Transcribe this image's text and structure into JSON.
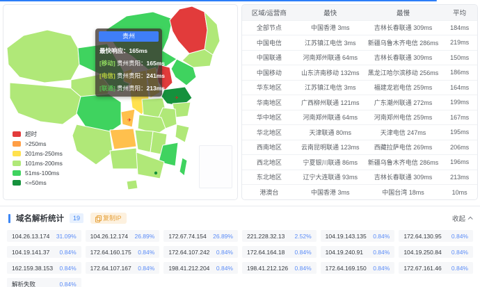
{
  "colors": {
    "accent_blue": "#2c7ef8",
    "tooltip_header": "#3f7ef7",
    "pct_blue": "#5b8cf7",
    "copy_orange": "#e6a23c",
    "badge_blue": "#4086f4",
    "red": "#e23b3b",
    "orange": "#ff9e45",
    "yellow": "#ffe14e",
    "light_green": "#b0e878",
    "bright_green": "#3fd35f",
    "dark_green": "#15913c",
    "hover_amber": "#ffc04d"
  },
  "map": {
    "tooltip": {
      "title": "贵州",
      "fastest_label": "最快响应：",
      "fastest_value": "165ms",
      "rows": [
        {
          "tag": "[移动]",
          "tag_color": "#90d95f",
          "label": "贵州贵阳：",
          "value": "165ms"
        },
        {
          "tag": "[电信]",
          "tag_color": "#bdd13f",
          "label": "贵州贵阳：",
          "value": "241ms"
        },
        {
          "tag": "[联通]",
          "tag_color": "#52b54f",
          "label": "贵州贵阳：",
          "value": "213ms"
        }
      ]
    },
    "legend": [
      {
        "label": "超时",
        "color": "#e23b3b"
      },
      {
        "label": ">250ms",
        "color": "#ff9e45"
      },
      {
        "label": "201ms-250ms",
        "color": "#ffe14e"
      },
      {
        "label": "101ms-200ms",
        "color": "#b0e878"
      },
      {
        "label": "51ms-100ms",
        "color": "#3fd35f"
      },
      {
        "label": "<=50ms",
        "color": "#15913c"
      }
    ],
    "regions": [
      {
        "id": "xinjiang",
        "color": "#b0e878"
      },
      {
        "id": "tibet",
        "color": "#b0e878"
      },
      {
        "id": "qinghai",
        "color": "#b0e878"
      },
      {
        "id": "gansu",
        "color": "#3fd35f"
      },
      {
        "id": "neimeng",
        "color": "#3fd35f"
      },
      {
        "id": "heilongjiang",
        "color": "#e23b3b"
      },
      {
        "id": "hljeast",
        "color": "#b0e878"
      },
      {
        "id": "jilin",
        "color": "#b0e878"
      },
      {
        "id": "liaoning",
        "color": "#3fd35f"
      },
      {
        "id": "hebei",
        "color": "#e23b3b"
      },
      {
        "id": "shanxi",
        "color": "#ffe14e"
      },
      {
        "id": "shaanxi",
        "color": "#ffe14e"
      },
      {
        "id": "ningxia",
        "color": "#ffe14e"
      },
      {
        "id": "shandong",
        "color": "#15913c"
      },
      {
        "id": "henan",
        "color": "#b0e878"
      },
      {
        "id": "jiangsu",
        "color": "#b0e878"
      },
      {
        "id": "anhui",
        "color": "#b0e878"
      },
      {
        "id": "hubei",
        "color": "#b0e878"
      },
      {
        "id": "chongqing",
        "color": "#ffc04d"
      },
      {
        "id": "sichuan",
        "color": "#3fd35f"
      },
      {
        "id": "guizhou",
        "color": "#ffc04d"
      },
      {
        "id": "hunan",
        "color": "#b0e878"
      },
      {
        "id": "jiangxi",
        "color": "#b0e878"
      },
      {
        "id": "zhejiang",
        "color": "#b0e878"
      },
      {
        "id": "fujian",
        "color": "#3fd35f"
      },
      {
        "id": "yunnan",
        "color": "#b0e878"
      },
      {
        "id": "guangxi",
        "color": "#b0e878"
      },
      {
        "id": "guangdong",
        "color": "#b0e878"
      },
      {
        "id": "hainan",
        "color": "#b0e878"
      },
      {
        "id": "taiwan",
        "color": "#3fd35f"
      }
    ],
    "markers": [
      "beijing",
      "jinan",
      "xian",
      "chongqing"
    ]
  },
  "latency_table": {
    "headers": [
      "区域/运营商",
      "最快",
      "最慢",
      "平均"
    ],
    "rows": [
      {
        "region": "全部节点",
        "fastest": "中国香港 3ms",
        "slowest": "吉林长春联通 309ms",
        "avg": "184ms"
      },
      {
        "region": "中国电信",
        "fastest": "江苏镇江电信 3ms",
        "slowest": "新疆乌鲁木齐电信 286ms",
        "avg": "219ms"
      },
      {
        "region": "中国联通",
        "fastest": "河南郑州联通 64ms",
        "slowest": "吉林长春联通 309ms",
        "avg": "150ms"
      },
      {
        "region": "中国移动",
        "fastest": "山东济南移动 132ms",
        "slowest": "黑龙江哈尔滨移动 256ms",
        "avg": "186ms"
      },
      {
        "region": "华东地区",
        "fastest": "江苏镇江电信 3ms",
        "slowest": "福建龙岩电信 259ms",
        "avg": "164ms"
      },
      {
        "region": "华南地区",
        "fastest": "广西柳州联通 121ms",
        "slowest": "广东潮州联通 272ms",
        "avg": "199ms"
      },
      {
        "region": "华中地区",
        "fastest": "河南郑州联通 64ms",
        "slowest": "河南郑州电信 259ms",
        "avg": "167ms"
      },
      {
        "region": "华北地区",
        "fastest": "天津联通 80ms",
        "slowest": "天津电信 247ms",
        "avg": "195ms"
      },
      {
        "region": "西南地区",
        "fastest": "云南昆明联通 123ms",
        "slowest": "西藏拉萨电信 269ms",
        "avg": "206ms"
      },
      {
        "region": "西北地区",
        "fastest": "宁夏银川联通 86ms",
        "slowest": "新疆乌鲁木齐电信 286ms",
        "avg": "196ms"
      },
      {
        "region": "东北地区",
        "fastest": "辽宁大连联通 93ms",
        "slowest": "吉林长春联通 309ms",
        "avg": "213ms"
      },
      {
        "region": "港澳台",
        "fastest": "中国香港 3ms",
        "slowest": "中国台湾 18ms",
        "avg": "10ms"
      }
    ]
  },
  "dns_section": {
    "title": "域名解析统计",
    "count_badge": "19",
    "copy_button_label": "复制IP",
    "collapse_label": "收起",
    "entries": [
      {
        "label": "104.26.13.174",
        "pct": "31.09%"
      },
      {
        "label": "104.26.12.174",
        "pct": "26.89%"
      },
      {
        "label": "172.67.74.154",
        "pct": "26.89%"
      },
      {
        "label": "221.228.32.13",
        "pct": "2.52%"
      },
      {
        "label": "104.19.143.135",
        "pct": "0.84%"
      },
      {
        "label": "172.64.130.95",
        "pct": "0.84%"
      },
      {
        "label": "104.19.141.37",
        "pct": "0.84%"
      },
      {
        "label": "172.64.160.175",
        "pct": "0.84%"
      },
      {
        "label": "172.64.107.242",
        "pct": "0.84%"
      },
      {
        "label": "172.64.164.18",
        "pct": "0.84%"
      },
      {
        "label": "104.19.240.91",
        "pct": "0.84%"
      },
      {
        "label": "104.19.250.84",
        "pct": "0.84%"
      },
      {
        "label": "162.159.38.153",
        "pct": "0.84%"
      },
      {
        "label": "172.64.107.167",
        "pct": "0.84%"
      },
      {
        "label": "198.41.212.204",
        "pct": "0.84%"
      },
      {
        "label": "198.41.212.126",
        "pct": "0.84%"
      },
      {
        "label": "172.64.169.150",
        "pct": "0.84%"
      },
      {
        "label": "172.67.161.46",
        "pct": "0.84%"
      },
      {
        "label": "解析失败",
        "pct": "0.84%"
      }
    ]
  }
}
